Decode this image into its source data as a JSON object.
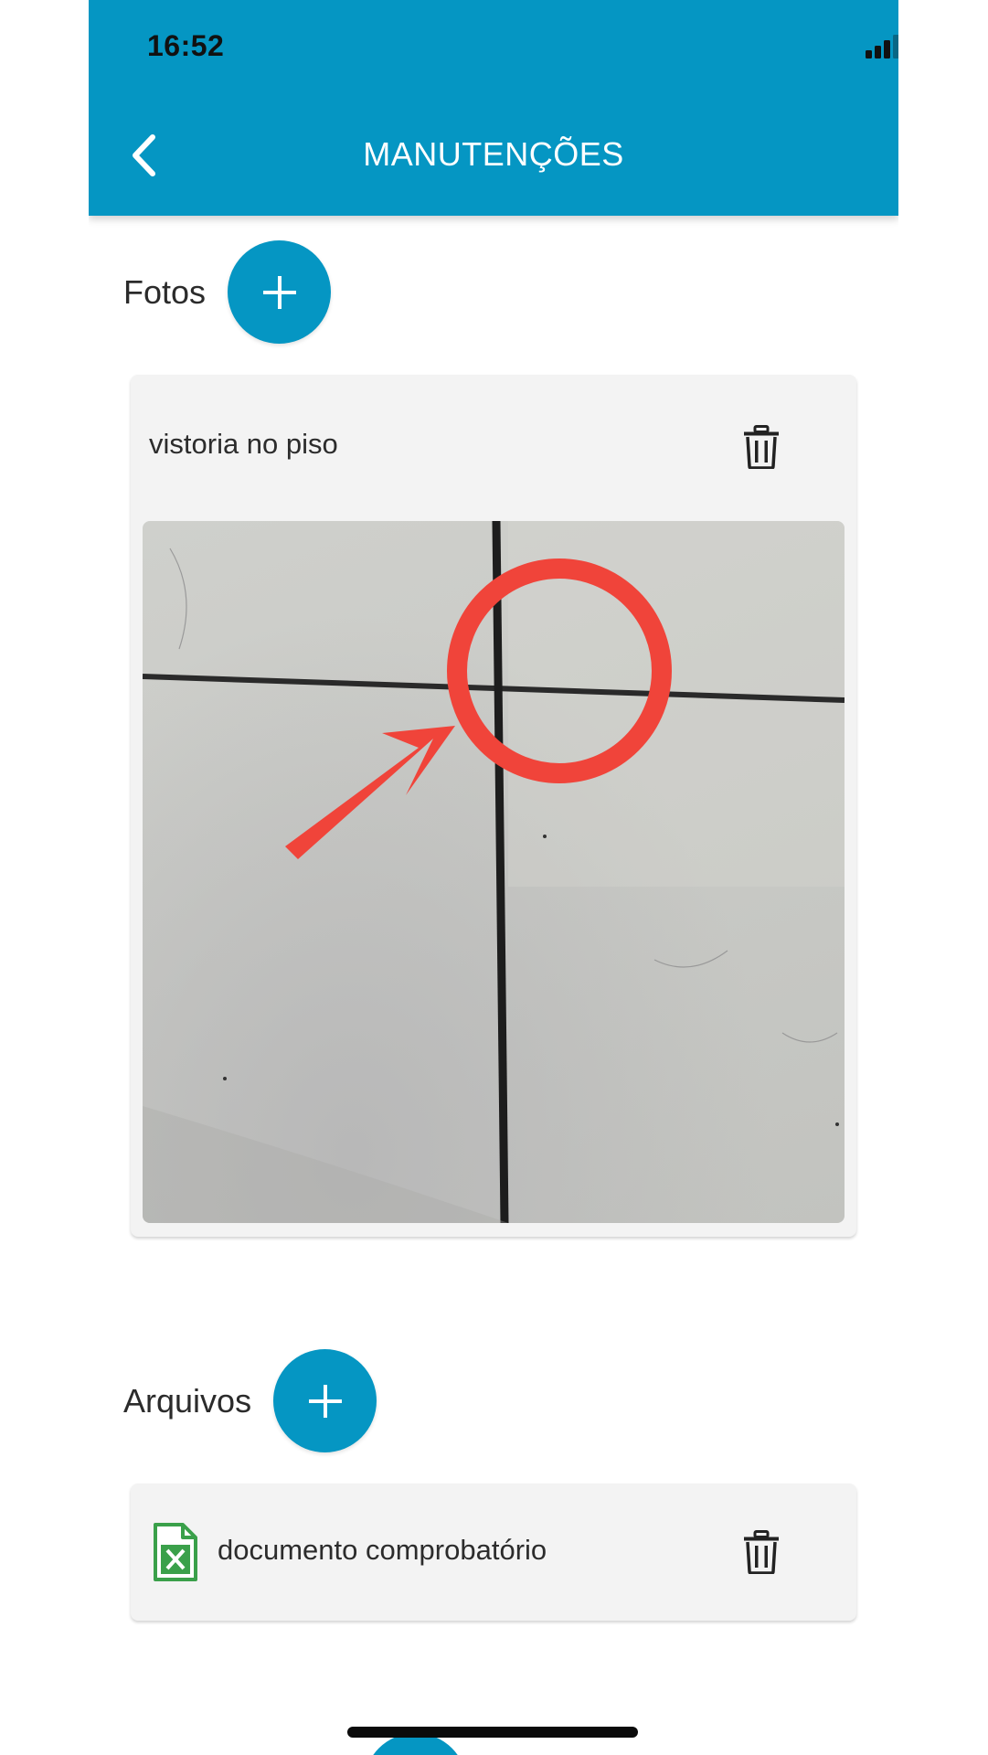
{
  "status_bar": {
    "time": "16:52"
  },
  "app_bar": {
    "title": "MANUTENÇÕES"
  },
  "photos_section": {
    "label": "Fotos",
    "items": [
      {
        "caption": "vistoria no piso"
      }
    ]
  },
  "files_section": {
    "label": "Arquivos",
    "items": [
      {
        "name": "documento comprobatório",
        "icon": "excel-file-icon"
      }
    ]
  },
  "colors": {
    "primary": "#0596c3",
    "card_bg": "#f3f3f3",
    "annotation_red": "#f0443a",
    "excel_green": "#3aa04a"
  }
}
